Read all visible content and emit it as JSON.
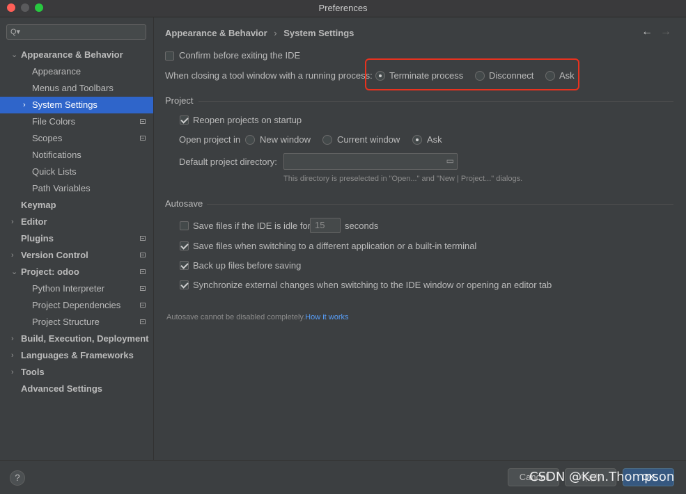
{
  "window": {
    "title": "Preferences"
  },
  "search": {
    "placeholder": ""
  },
  "sidebar": {
    "items": [
      {
        "label": "Appearance & Behavior",
        "chevron": "⌄"
      },
      {
        "label": "Appearance"
      },
      {
        "label": "Menus and Toolbars"
      },
      {
        "label": "System Settings",
        "chevron": "›"
      },
      {
        "label": "File Colors"
      },
      {
        "label": "Scopes"
      },
      {
        "label": "Notifications"
      },
      {
        "label": "Quick Lists"
      },
      {
        "label": "Path Variables"
      },
      {
        "label": "Keymap"
      },
      {
        "label": "Editor",
        "chevron": "›"
      },
      {
        "label": "Plugins"
      },
      {
        "label": "Version Control",
        "chevron": "›"
      },
      {
        "label": "Project: odoo",
        "chevron": "⌄"
      },
      {
        "label": "Python Interpreter"
      },
      {
        "label": "Project Dependencies"
      },
      {
        "label": "Project Structure"
      },
      {
        "label": "Build, Execution, Deployment",
        "chevron": "›"
      },
      {
        "label": "Languages & Frameworks",
        "chevron": "›"
      },
      {
        "label": "Tools",
        "chevron": "›"
      },
      {
        "label": "Advanced Settings"
      }
    ]
  },
  "breadcrumb": {
    "parent": "Appearance & Behavior",
    "separator": "›",
    "current": "System Settings",
    "back": "←",
    "forward": "→"
  },
  "general": {
    "confirm_exit": {
      "label": "Confirm before exiting the IDE",
      "checked": false
    },
    "closing_label": "When closing a tool window with a running process:",
    "closing_options": [
      "Terminate process",
      "Disconnect",
      "Ask"
    ],
    "closing_selected": "Terminate process"
  },
  "project": {
    "title": "Project",
    "reopen": {
      "label": "Reopen projects on startup",
      "checked": true
    },
    "open_in_label": "Open project in",
    "open_in_options": [
      "New window",
      "Current window",
      "Ask"
    ],
    "open_in_selected": "Ask",
    "dir_label": "Default project directory:",
    "dir_value": "",
    "dir_hint": "This directory is preselected in \"Open...\" and \"New | Project...\" dialogs."
  },
  "autosave": {
    "title": "Autosave",
    "idle": {
      "label": "Save files if the IDE is idle for",
      "checked": false,
      "seconds_value": "15",
      "seconds_label": "seconds"
    },
    "switching": {
      "label": "Save files when switching to a different application or a built-in terminal",
      "checked": true
    },
    "backup": {
      "label": "Back up files before saving",
      "checked": true
    },
    "sync": {
      "label": "Synchronize external changes when switching to the IDE window or opening an editor tab",
      "checked": true
    },
    "note": "Autosave cannot be disabled completely.",
    "note_link": "How it works"
  },
  "footer": {
    "help": "?",
    "cancel": "Cancel",
    "apply": "Apply",
    "ok": "OK"
  },
  "watermark": "CSDN @Ken.Thompson",
  "colors": {
    "selection": "#2f65ca",
    "highlight_box": "#e8321e",
    "link": "#589df6",
    "ok_button": "#365880"
  }
}
